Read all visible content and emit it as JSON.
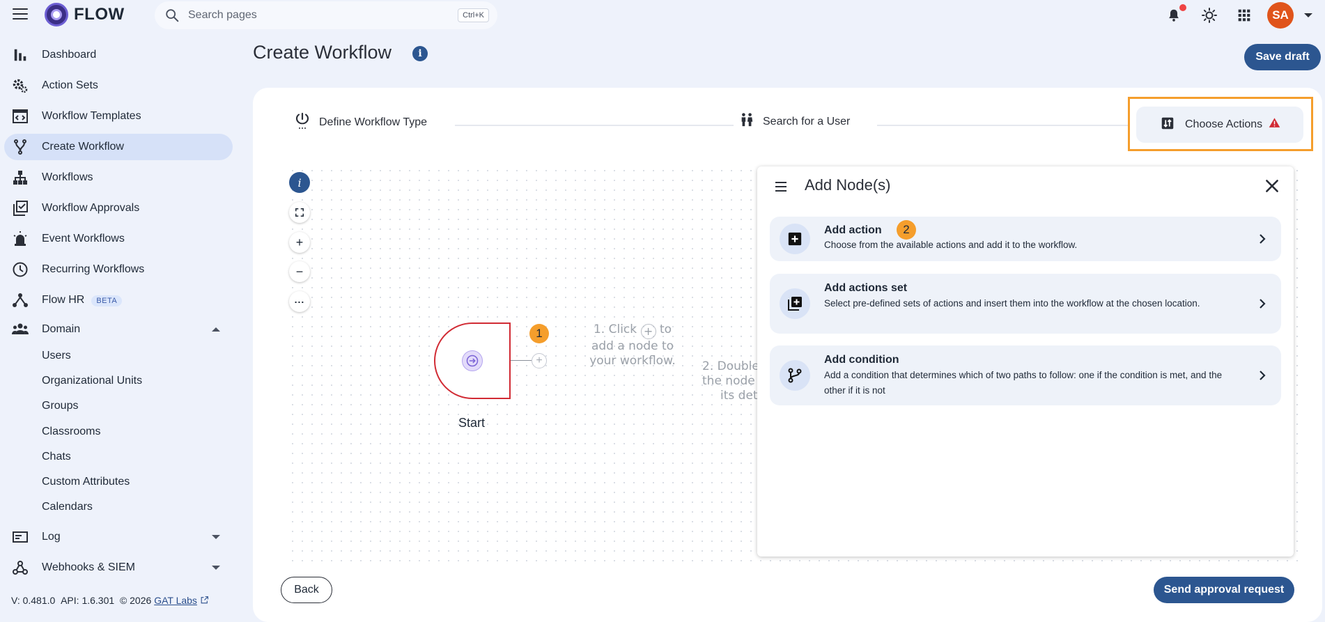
{
  "app": {
    "name": "FLOW",
    "avatar_initials": "SA"
  },
  "search": {
    "placeholder": "Search pages",
    "shortcut": "Ctrl+K"
  },
  "sidebar": {
    "items": [
      {
        "label": "Dashboard",
        "icon": "bar-chart-icon"
      },
      {
        "label": "Action Sets",
        "icon": "gears-icon"
      },
      {
        "label": "Workflow Templates",
        "icon": "template-icon"
      },
      {
        "label": "Create Workflow",
        "icon": "fork-icon",
        "active": true
      },
      {
        "label": "Workflows",
        "icon": "hierarchy-icon"
      },
      {
        "label": "Workflow Approvals",
        "icon": "approval-icon"
      },
      {
        "label": "Event Workflows",
        "icon": "siren-icon"
      },
      {
        "label": "Recurring Workflows",
        "icon": "clock-icon"
      },
      {
        "label": "Flow HR",
        "badge": "BETA",
        "icon": "network-icon"
      },
      {
        "label": "Domain",
        "icon": "people-icon",
        "expanded": true
      },
      {
        "label": "Log",
        "icon": "log-icon"
      },
      {
        "label": "Webhooks & SIEM",
        "icon": "webhook-icon"
      }
    ],
    "domain_children": [
      "Users",
      "Organizational Units",
      "Groups",
      "Classrooms",
      "Chats",
      "Custom Attributes",
      "Calendars"
    ],
    "footer": {
      "version": "V: 0.481.0",
      "api": "API: 1.6.301",
      "copyright": "© 2026",
      "company": "GAT Labs"
    }
  },
  "page": {
    "title": "Create Workflow",
    "save_draft": "Save draft"
  },
  "stepper": {
    "steps": [
      {
        "label": "Define Workflow Type",
        "icon": "power-icon"
      },
      {
        "label": "Search for a User",
        "icon": "users-icon"
      },
      {
        "label": "Choose Actions",
        "icon": "actions-icon",
        "warning": true,
        "active": true
      }
    ]
  },
  "canvas": {
    "start_label": "Start",
    "badge_1": "1",
    "badge_2": "2",
    "hint_1_line1": "1. Click",
    "hint_1_line1b": "to",
    "hint_1_line2": "add a node to",
    "hint_1_line3": "your workflow.",
    "hint_2_line1": "2. Double",
    "hint_2_line2": "the node",
    "hint_2_line3": "its det"
  },
  "panel": {
    "title": "Add Node(s)",
    "options": [
      {
        "title": "Add action",
        "desc": "Choose from the available actions and add it to the workflow."
      },
      {
        "title": "Add actions set",
        "desc": "Select pre-defined sets of actions and insert them into the workflow at the chosen location."
      },
      {
        "title": "Add condition",
        "desc": "Add a condition that determines which of two paths to follow: one if the condition is met, and the other if it is not"
      }
    ]
  },
  "actions": {
    "back": "Back",
    "send": "Send approval request"
  },
  "colors": {
    "primary": "#2c5690",
    "accent": "#f59e2c",
    "danger": "#d12b34",
    "avatar": "#e0541b"
  }
}
